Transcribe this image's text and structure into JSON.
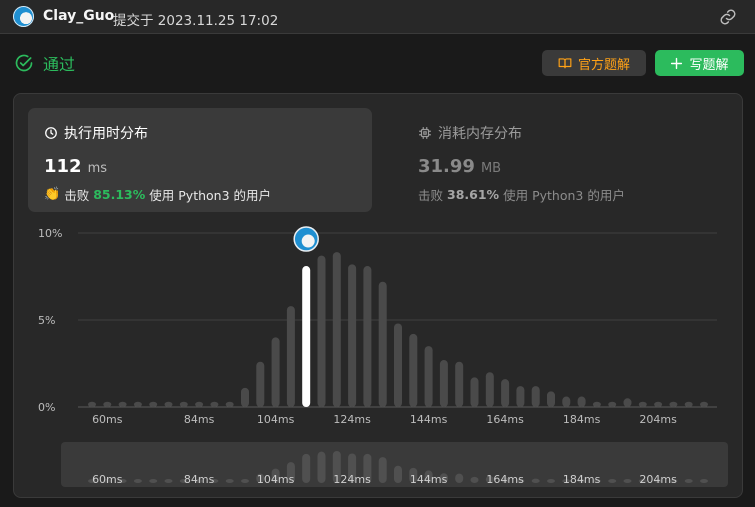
{
  "header": {
    "username": "Clay_Guo",
    "submitted_text": "提交于 2023.11.25 17:02"
  },
  "status": {
    "label": "通过"
  },
  "buttons": {
    "solutions_label": "官方题解",
    "write_label": "写题解"
  },
  "runtime": {
    "title": "执行用时分布",
    "value": "112",
    "unit": "ms",
    "beat_prefix": "击败",
    "beat_percent": "85.13%",
    "beat_suffix": "使用 Python3 的用户"
  },
  "memory": {
    "title": "消耗内存分布",
    "value": "31.99",
    "unit": "MB",
    "beat_prefix": "击败",
    "beat_percent": "38.61%",
    "beat_suffix": "使用 Python3 的用户"
  },
  "colors": {
    "accept_green": "#2cbb5d",
    "accent_orange": "#ffa116",
    "bar": "#4a4a4a",
    "bar_selected": "#ffffff"
  },
  "chart_data": {
    "type": "bar",
    "ylabel": "",
    "xlabel": "",
    "ylim": [
      0,
      10
    ],
    "y_ticks": [
      "0%",
      "5%",
      "10%"
    ],
    "x_ticks": [
      "60ms",
      "84ms",
      "104ms",
      "124ms",
      "144ms",
      "164ms",
      "184ms",
      "204ms"
    ],
    "categories": [
      56,
      60,
      64,
      68,
      72,
      76,
      80,
      84,
      88,
      92,
      96,
      100,
      104,
      108,
      112,
      116,
      120,
      124,
      128,
      132,
      136,
      140,
      144,
      148,
      152,
      156,
      160,
      164,
      168,
      172,
      176,
      180,
      184,
      188,
      192,
      196,
      200,
      204,
      208,
      212,
      216
    ],
    "values": [
      0.3,
      0.3,
      0.3,
      0.3,
      0.3,
      0.3,
      0.3,
      0.3,
      0.3,
      0.3,
      1.1,
      2.6,
      4.0,
      5.8,
      8.1,
      8.7,
      8.9,
      8.2,
      8.1,
      7.2,
      4.8,
      4.2,
      3.5,
      2.7,
      2.6,
      1.7,
      2.0,
      1.6,
      1.2,
      1.2,
      0.9,
      0.6,
      0.6,
      0.3,
      0.3,
      0.5,
      0.3,
      0.3,
      0.3,
      0.3,
      0.3
    ],
    "selected_index": 14,
    "grid": true
  }
}
